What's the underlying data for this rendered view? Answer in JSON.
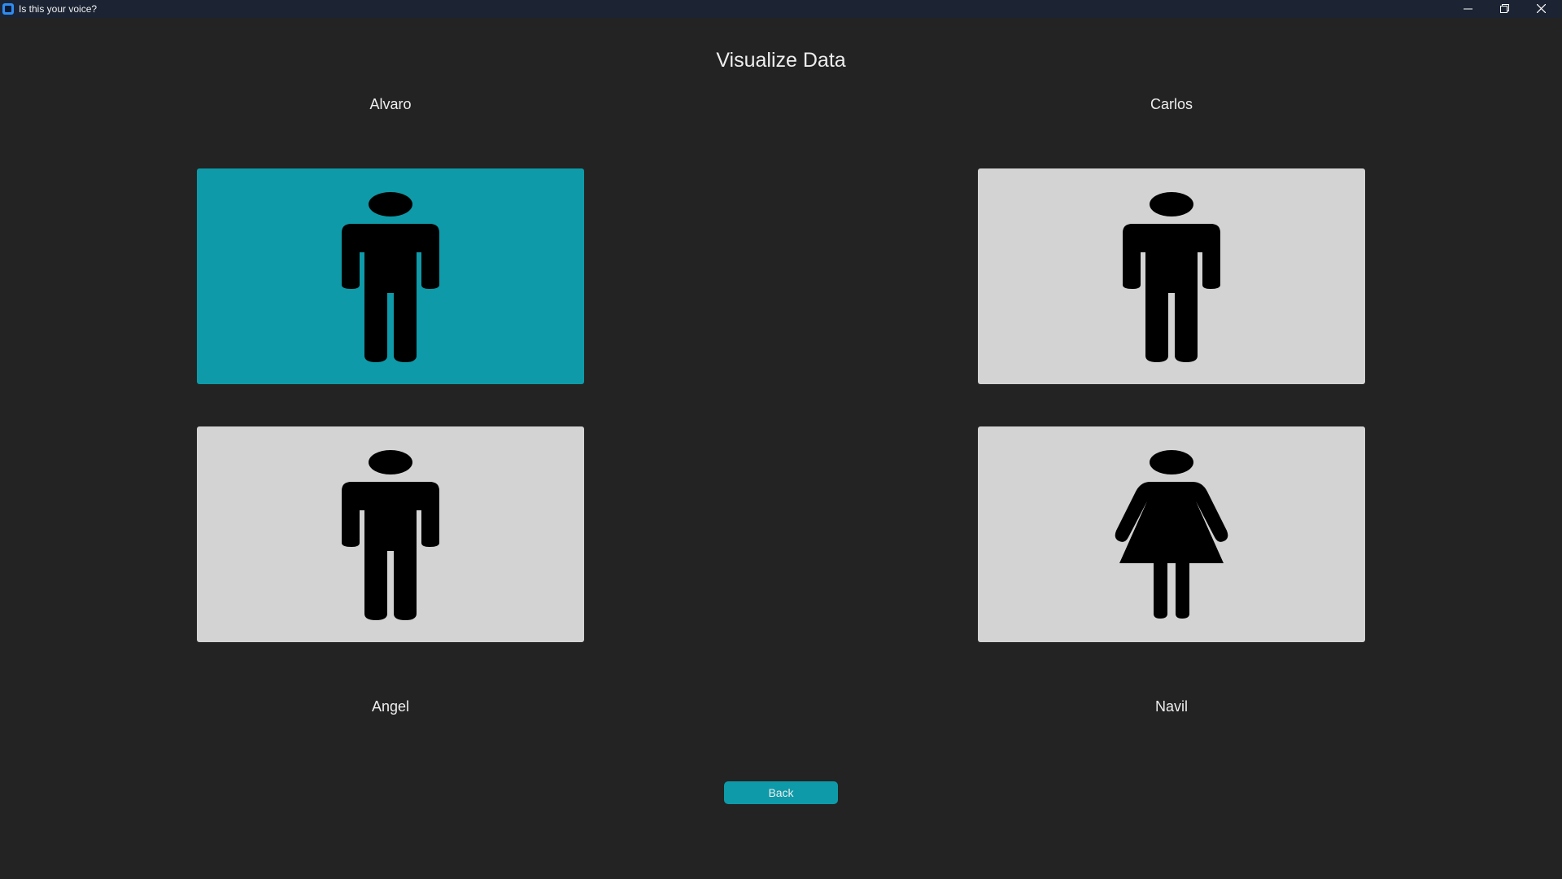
{
  "window": {
    "title": "Is this your voice?",
    "controls": [
      "minimize",
      "restore",
      "close"
    ]
  },
  "page": {
    "title": "Visualize Data"
  },
  "users": [
    {
      "name": "Alvaro",
      "figure": "male-figure-icon",
      "selected": true
    },
    {
      "name": "Carlos",
      "figure": "male-figure-icon",
      "selected": false
    },
    {
      "name": "Angel",
      "figure": "male-figure-icon",
      "selected": false
    },
    {
      "name": "Navil",
      "figure": "female-figure-icon",
      "selected": false
    }
  ],
  "actions": {
    "back_label": "Back"
  },
  "colors": {
    "accent": "#0e9aa8",
    "card": "#d3d3d3",
    "background": "#232323",
    "titlebar": "#1c2433"
  }
}
